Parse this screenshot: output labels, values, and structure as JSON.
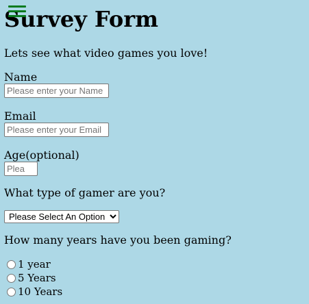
{
  "header": {
    "title": "Survey Form",
    "intro": "Lets see what video games you love!"
  },
  "fields": {
    "name": {
      "label": "Name",
      "placeholder": "Please enter your Name",
      "value": ""
    },
    "email": {
      "label": "Email",
      "placeholder": "Please enter your Email",
      "value": ""
    },
    "age": {
      "label": "Age(optional)",
      "placeholder": "Please enter your Age",
      "value": ""
    }
  },
  "gamer_type": {
    "question": "What type of gamer are you?",
    "selected": "Please Select An Option"
  },
  "years_gaming": {
    "question": "How many years have you been gaming?",
    "options": [
      {
        "label": "1 year",
        "checked": false
      },
      {
        "label": "5 Years",
        "checked": false
      },
      {
        "label": "10 Years",
        "checked": false
      }
    ]
  },
  "icons": {
    "menu": "hamburger-menu-icon"
  },
  "colors": {
    "background": "#add8e6",
    "menu_icon": "#0a7a1e"
  }
}
